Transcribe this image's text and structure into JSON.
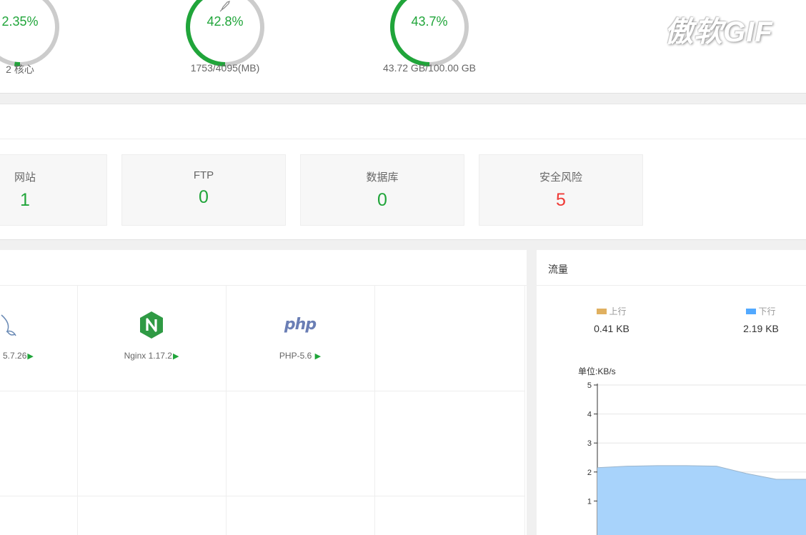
{
  "gauges": {
    "cpu": {
      "percent_label": "2.35%",
      "percent": 2.35,
      "sub": "2 核心"
    },
    "memory": {
      "percent_label": "42.8%",
      "percent": 42.8,
      "sub": "1753/4095(MB)",
      "icon": "rocket-icon"
    },
    "disk": {
      "percent_label": "43.7%",
      "percent": 43.7,
      "sub": "43.72 GB/100.00 GB"
    }
  },
  "watermark": "傲软GIF",
  "overview": {
    "cards": [
      {
        "label": "网站",
        "value": "1"
      },
      {
        "label": "FTP",
        "value": "0"
      },
      {
        "label": "数据库",
        "value": "0"
      },
      {
        "label": "安全风险",
        "value": "5"
      }
    ]
  },
  "software": {
    "items": [
      {
        "name": "5.7.26",
        "icon": "mysql-icon"
      },
      {
        "name": "Nginx 1.17.2",
        "icon": "nginx-icon"
      },
      {
        "name": "PHP-5.6",
        "icon": "php-icon",
        "logo_text": "php"
      }
    ]
  },
  "traffic": {
    "title": "流量",
    "upload": {
      "label": "上行",
      "value": "0.41 KB",
      "color": "#e0b060"
    },
    "download": {
      "label": "下行",
      "value": "2.19 KB",
      "color": "#52a9ff"
    },
    "unit": "单位:KB/s"
  },
  "colors": {
    "accent": "#20a53a",
    "danger": "#ef3a36",
    "ring_track": "#cccccc"
  },
  "chart_data": {
    "type": "area",
    "ylabel": "单位:KB/s",
    "ylim": [
      0,
      5
    ],
    "yticks": [
      "1",
      "2",
      "3",
      "4",
      "5"
    ],
    "series": [
      {
        "values": [
          2.15,
          2.2,
          2.22,
          2.22,
          2.2,
          1.95,
          1.75,
          1.75
        ]
      }
    ]
  }
}
